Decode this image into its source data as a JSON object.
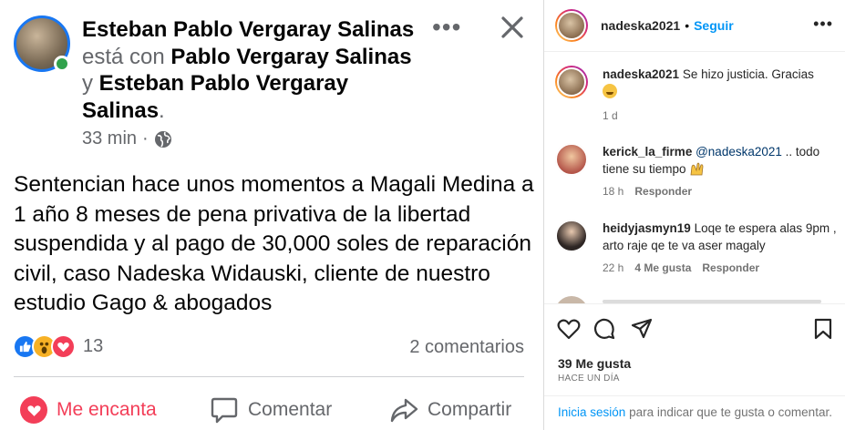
{
  "facebook_post": {
    "author": "Esteban Pablo Vergaray Salinas",
    "with_prefix": "está con",
    "tagged_1": "Pablo Vergaray Salinas",
    "and_word": "y",
    "tagged_2": "Esteban Pablo Vergaray Salinas",
    "period": ".",
    "time": "33 min",
    "separator": "·",
    "more_label": "•••",
    "body": "Sentencian hace unos momentos a Magali Medina a 1 año 8 meses de pena privativa de la libertad suspendida y al pago de 30,000 soles de reparación civil, caso Nadeska Widauski, cliente de nuestro estudio Gago & abogados",
    "reaction_count": "13",
    "comment_count": "2 comentarios",
    "actions": {
      "love": "Me encanta",
      "comment": "Comentar",
      "share": "Compartir"
    },
    "colors": {
      "accent": "#1877f2",
      "love": "#f33e58",
      "online": "#31a24c"
    }
  },
  "instagram": {
    "header": {
      "username": "nadeska2021",
      "dot": "•",
      "follow": "Seguir"
    },
    "comments": [
      {
        "username": "nadeska2021",
        "text": "Se hizo justicia. Gracias",
        "time": "1 d",
        "likes": "",
        "reply": ""
      },
      {
        "username": "kerick_la_firme",
        "mention": "@nadeska2021",
        "text": ".. todo tiene su tiempo",
        "time": "18 h",
        "likes": "",
        "reply": "Responder"
      },
      {
        "username": "heidyjasmyn19",
        "text": "Loqe te espera alas 9pm , arto raje qe te va aser magaly",
        "time": "22 h",
        "likes": "4 Me gusta",
        "reply": "Responder"
      }
    ],
    "likes": "39 Me gusta",
    "ago": "HACE UN DÍA",
    "login_link": "Inicia sesión",
    "login_text": "para indicar que te gusta o comentar.",
    "colors": {
      "link": "#0095f6",
      "mention": "#00376b"
    }
  }
}
